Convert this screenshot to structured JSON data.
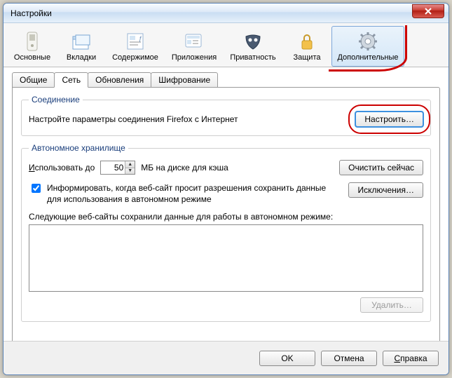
{
  "window": {
    "title": "Настройки",
    "close_aria": "Закрыть"
  },
  "toolbar": {
    "items": [
      {
        "label": "Основные"
      },
      {
        "label": "Вкладки"
      },
      {
        "label": "Содержимое"
      },
      {
        "label": "Приложения"
      },
      {
        "label": "Приватность"
      },
      {
        "label": "Защита"
      },
      {
        "label": "Дополнительные"
      }
    ]
  },
  "subtabs": {
    "items": [
      {
        "label": "Общие"
      },
      {
        "label": "Сеть"
      },
      {
        "label": "Обновления"
      },
      {
        "label": "Шифрование"
      }
    ]
  },
  "connection": {
    "legend": "Соединение",
    "desc": "Настройте параметры соединения Firefox с Интернет",
    "configure_btn": "Настроить…"
  },
  "offline": {
    "legend": "Автономное хранилище",
    "use_up_to": "Использовать до",
    "use_up_to_key": "И",
    "cache_value": "50",
    "mb_suffix": "МБ на диске для кэша",
    "clear_now": "Очистить сейчас",
    "inform_label": "Информировать, когда веб-сайт просит разрешения сохранить данные для использования в автономном режиме",
    "inform_checked": true,
    "exceptions_btn": "Исключения…",
    "stored_label": "Следующие веб-сайты сохранили данные для работы в автономном режиме:",
    "delete_btn": "Удалить…"
  },
  "footer": {
    "ok": "OK",
    "cancel": "Отмена",
    "help": "Справка",
    "help_key": "С"
  }
}
